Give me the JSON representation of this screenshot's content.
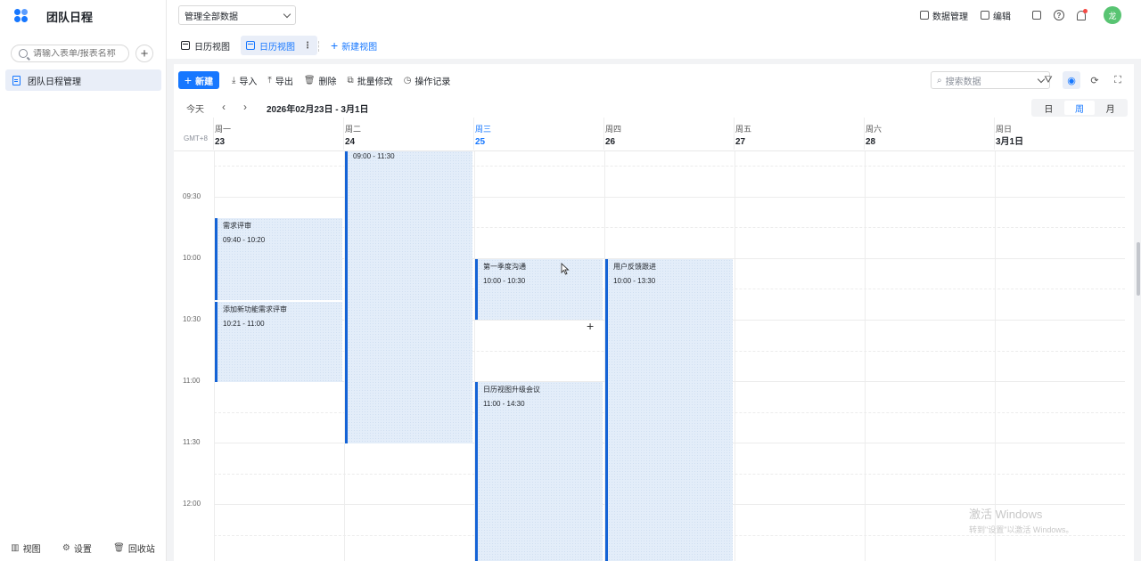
{
  "app": {
    "title": "团队日程"
  },
  "sidebar": {
    "search_placeholder": "请输入表单/报表名称",
    "item": "团队日程管理",
    "bottom": {
      "view": "视图",
      "settings": "设置",
      "recycle": "回收站"
    }
  },
  "topbar": {
    "data_scope": "管理全部数据",
    "data_manage": "数据管理",
    "edit": "编辑",
    "avatar": "龙"
  },
  "tabs": {
    "tab1": "日历视图",
    "tab2": "日历视图",
    "new_view": "新建视图"
  },
  "toolbar": {
    "new": "新建",
    "import": "导入",
    "export": "导出",
    "delete": "删除",
    "batch_edit": "批量修改",
    "history": "操作记录",
    "search_placeholder": "搜索数据"
  },
  "calnav": {
    "today": "今天",
    "range": "2026年02月23日 - 3月1日",
    "modes": [
      "日",
      "周",
      "月"
    ]
  },
  "timezone": "GMT+8",
  "days": [
    {
      "weekday": "周一",
      "date": "23"
    },
    {
      "weekday": "周二",
      "date": "24"
    },
    {
      "weekday": "周三",
      "date": "25"
    },
    {
      "weekday": "周四",
      "date": "26"
    },
    {
      "weekday": "周五",
      "date": "27"
    },
    {
      "weekday": "周六",
      "date": "28"
    },
    {
      "weekday": "周日",
      "date": "3月1日"
    }
  ],
  "times": [
    "09:30",
    "10:00",
    "10:30",
    "11:00",
    "11:30",
    "12:00"
  ],
  "events": [
    {
      "title": "",
      "time": "09:00 - 11:30"
    },
    {
      "title": "需求评审",
      "time": "09:40 - 10:20"
    },
    {
      "title": "添加新功能需求评审",
      "time": "10:21 - 11:00"
    },
    {
      "title": "第一季度沟通",
      "time": "10:00 - 10:30"
    },
    {
      "title": "用户反馈跟进",
      "time": "10:00 - 13:30"
    },
    {
      "title": "日历视图升级会议",
      "time": "11:00 - 14:30"
    }
  ],
  "watermark": {
    "line1": "激活 Windows",
    "line2": "转到\"设置\"以激活 Windows。"
  },
  "colors": {
    "accent": "#1677ff",
    "event_bg": "#e3edf9",
    "event_border": "#1463d6"
  }
}
